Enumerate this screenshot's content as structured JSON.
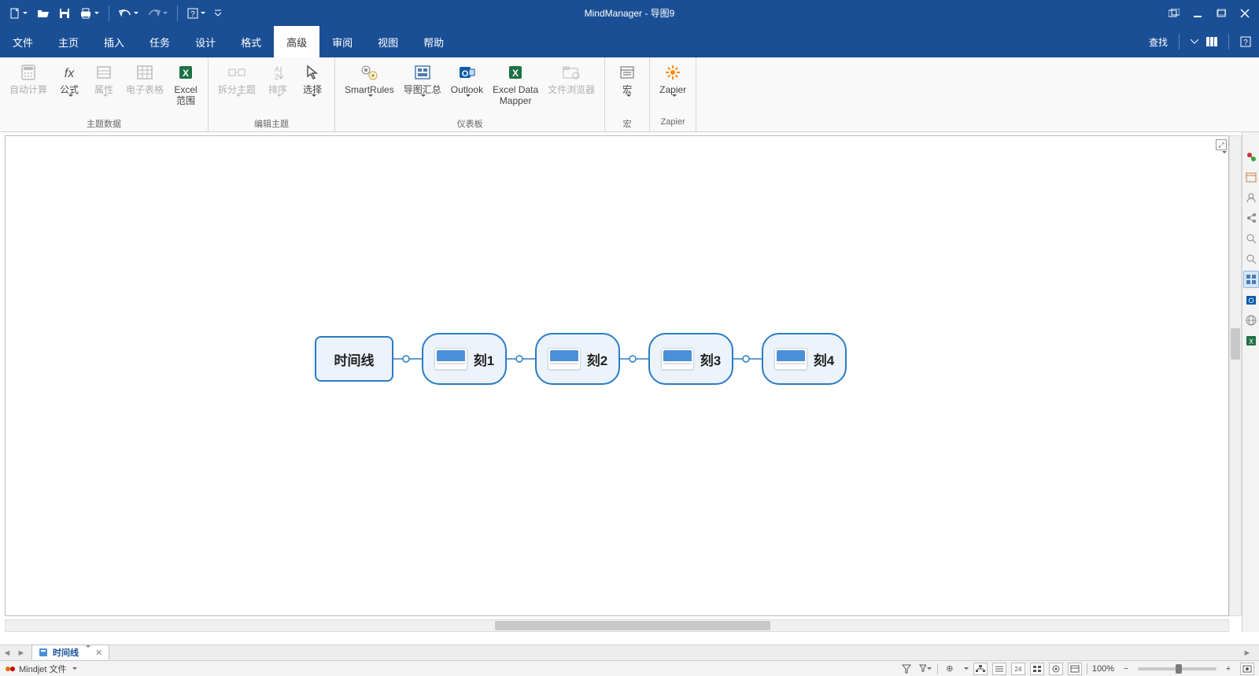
{
  "app_title": "MindManager - 导图9",
  "qat": {
    "new": "新建",
    "open": "打开",
    "save": "保存",
    "print": "打印",
    "undo": "撤销",
    "redo": "重做",
    "help": "帮助"
  },
  "tabs": {
    "items": [
      "文件",
      "主页",
      "插入",
      "任务",
      "设计",
      "格式",
      "高级",
      "审阅",
      "视图",
      "帮助"
    ],
    "active_index": 6,
    "right_search": "查找"
  },
  "ribbon": {
    "groups": [
      {
        "label": "主题数据",
        "buttons": [
          {
            "label": "自动计算",
            "icon": "calc-icon",
            "disabled": true,
            "dropdown": false
          },
          {
            "label": "公式",
            "icon": "formula-icon",
            "disabled": false,
            "dropdown": true
          },
          {
            "label": "属性",
            "icon": "properties-icon",
            "disabled": true,
            "dropdown": true
          },
          {
            "label": "电子表格",
            "icon": "spreadsheet-icon",
            "disabled": true,
            "dropdown": false
          },
          {
            "label": "Excel\n范围",
            "icon": "excel-range-icon",
            "disabled": false,
            "dropdown": false
          }
        ]
      },
      {
        "label": "编辑主题",
        "buttons": [
          {
            "label": "拆分主题",
            "icon": "split-icon",
            "disabled": true,
            "dropdown": true
          },
          {
            "label": "排序",
            "icon": "sort-icon",
            "disabled": true,
            "dropdown": true
          },
          {
            "label": "选择",
            "icon": "select-icon",
            "disabled": false,
            "dropdown": true
          }
        ]
      },
      {
        "label": "仪表板",
        "buttons": [
          {
            "label": "SmartRules",
            "icon": "smartrules-icon",
            "disabled": false,
            "dropdown": true
          },
          {
            "label": "导图汇总",
            "icon": "maprollup-icon",
            "disabled": false,
            "dropdown": true
          },
          {
            "label": "Outlook",
            "icon": "outlook-icon",
            "disabled": false,
            "dropdown": true
          },
          {
            "label": "Excel Data\nMapper",
            "icon": "excel-mapper-icon",
            "disabled": false,
            "dropdown": false
          },
          {
            "label": "文件浏览器",
            "icon": "file-browser-icon",
            "disabled": true,
            "dropdown": false
          }
        ]
      },
      {
        "label": "宏",
        "buttons": [
          {
            "label": "宏",
            "icon": "macro-icon",
            "disabled": false,
            "dropdown": true
          }
        ]
      },
      {
        "label": "Zapier",
        "buttons": [
          {
            "label": "Zapier",
            "icon": "zapier-icon",
            "disabled": false,
            "dropdown": true
          }
        ]
      }
    ]
  },
  "timeline": {
    "root": "时间线",
    "children": [
      "刻1",
      "刻2",
      "刻3",
      "刻4"
    ]
  },
  "doctab": {
    "name": "时间线"
  },
  "status": {
    "left": "Mindjet 文件",
    "zoom": "100%"
  },
  "side_icons": [
    "link-icon",
    "calendar-icon",
    "person-icon",
    "share-icon",
    "search-icon",
    "search2-icon",
    "grid-icon",
    "outlook-side-icon",
    "globe-icon",
    "excel-side-icon"
  ]
}
